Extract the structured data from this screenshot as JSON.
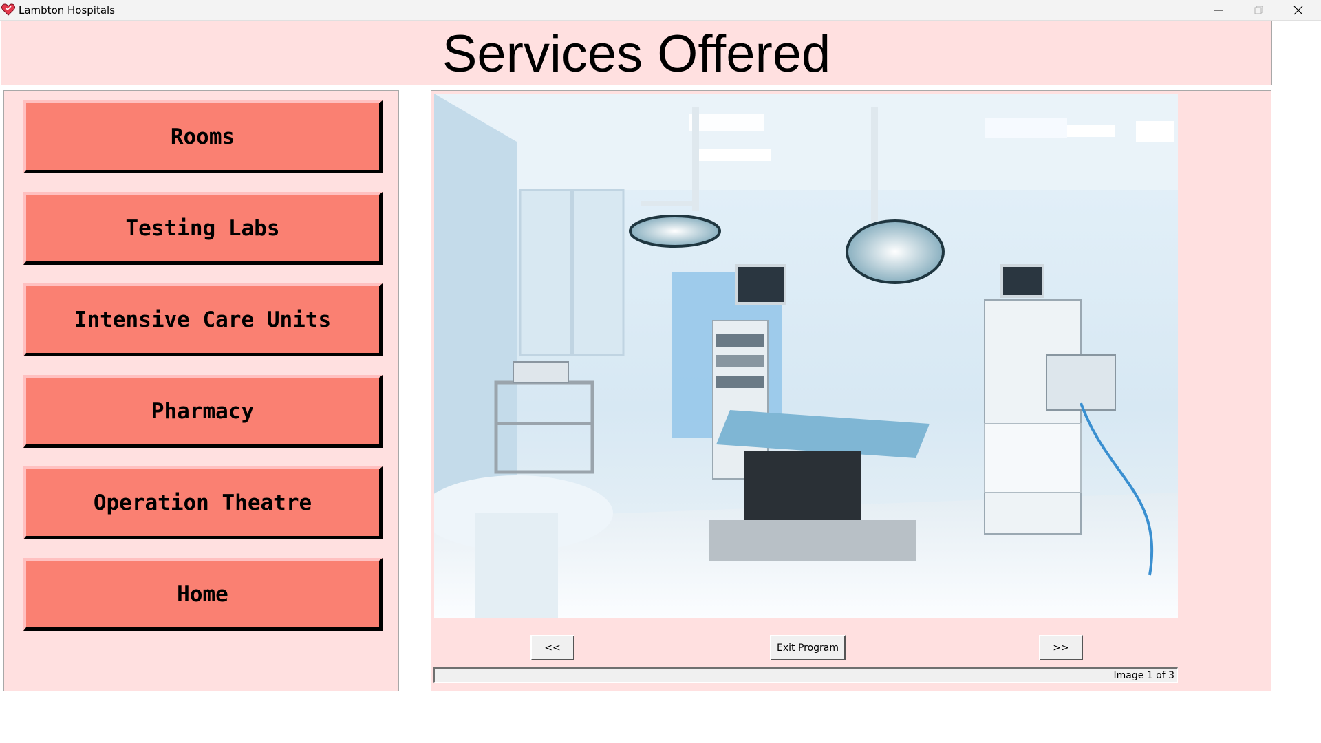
{
  "window": {
    "title": "Lambton Hospitals",
    "app_icon": "heart-icon",
    "controls": [
      "minimize-icon",
      "maximize-icon",
      "close-icon"
    ]
  },
  "header": {
    "title": "Services Offered"
  },
  "nav": {
    "items": [
      {
        "label": "Rooms"
      },
      {
        "label": "Testing Labs"
      },
      {
        "label": "Intensive Care Units"
      },
      {
        "label": "Pharmacy"
      },
      {
        "label": "Operation Theatre"
      },
      {
        "label": "Home"
      }
    ]
  },
  "viewer": {
    "prev_label": "<<",
    "exit_label": "Exit Program",
    "next_label": ">>",
    "status": "Image 1 of 3",
    "current_index": 1,
    "total_images": 3
  },
  "colors": {
    "panel_bg": "#ffe0e0",
    "button_bg": "#fa8072",
    "button_highlight": "#ffc0c0",
    "button_shadow": "#000000"
  }
}
